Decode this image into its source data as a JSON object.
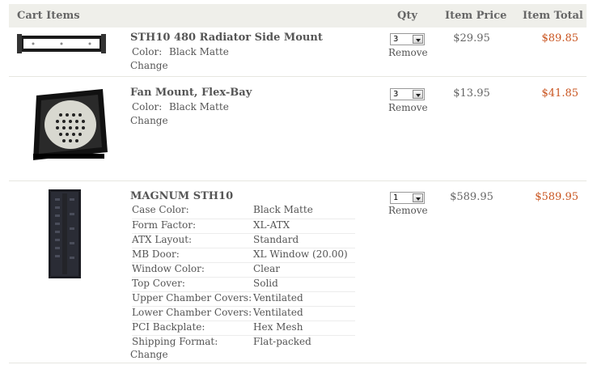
{
  "header": {
    "items": "Cart Items",
    "qty": "Qty",
    "item_price": "Item Price",
    "item_total": "Item Total"
  },
  "rows": [
    {
      "name": "STH10 480 Radiator Side Mount",
      "attributes": [
        {
          "label": "Color:",
          "value": "Black Matte"
        }
      ],
      "change": "Change",
      "qty": "3",
      "remove": "Remove",
      "price": "$29.95",
      "total": "$89.85",
      "image": "radiator-mount-image"
    },
    {
      "name": "Fan Mount, Flex-Bay",
      "attributes": [
        {
          "label": "Color:",
          "value": "Black Matte"
        }
      ],
      "change": "Change",
      "qty": "3",
      "remove": "Remove",
      "price": "$13.95",
      "total": "$41.85",
      "image": "fan-mount-image"
    },
    {
      "name": "MAGNUM STH10",
      "options": [
        {
          "label": "Case Color:",
          "value": "Black Matte"
        },
        {
          "label": "Form Factor:",
          "value": "XL-ATX"
        },
        {
          "label": "ATX Layout:",
          "value": "Standard"
        },
        {
          "label": "MB Door:",
          "value": "XL Window (20.00)"
        },
        {
          "label": "Window Color:",
          "value": "Clear"
        },
        {
          "label": "Top Cover:",
          "value": "Solid"
        },
        {
          "label": "Upper Chamber Covers:",
          "value": "Ventilated"
        },
        {
          "label": "Lower Chamber Covers:",
          "value": "Ventilated"
        },
        {
          "label": "PCI Backplate:",
          "value": "Hex Mesh"
        },
        {
          "label": "Shipping Format:",
          "value": "Flat-packed"
        }
      ],
      "change": "Change",
      "qty": "1",
      "remove": "Remove",
      "price": "$589.95",
      "total": "$589.95",
      "image": "case-tower-image"
    }
  ],
  "colors": {
    "header_bg": "#efefea",
    "total": "#c9541f"
  }
}
